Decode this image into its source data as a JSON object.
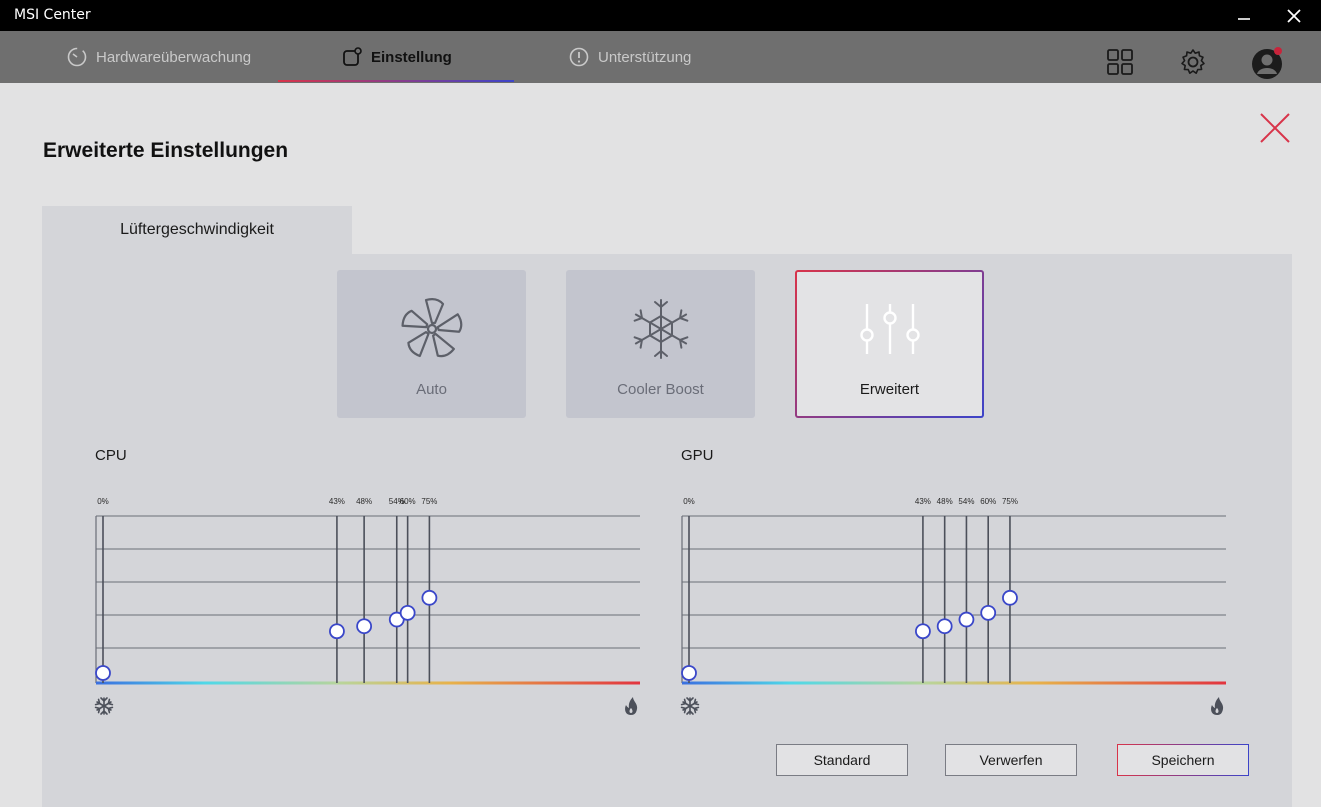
{
  "window": {
    "title": "MSI Center"
  },
  "nav": {
    "tabs": [
      {
        "label": "Hardwareüberwachung",
        "icon": "gauge-icon",
        "active": false
      },
      {
        "label": "Einstellung",
        "icon": "settings-square-icon",
        "active": true
      },
      {
        "label": "Unterstützung",
        "icon": "alert-circle-icon",
        "active": false
      }
    ],
    "right_icons": [
      "grid-icon",
      "gear-icon",
      "avatar"
    ]
  },
  "dialog": {
    "title": "Erweiterte Einstellungen",
    "tab": "Lüftergeschwindigkeit",
    "modes": [
      {
        "label": "Auto",
        "icon": "fan-icon",
        "selected": false
      },
      {
        "label": "Cooler Boost",
        "icon": "snowflake-icon",
        "selected": false
      },
      {
        "label": "Erweitert",
        "icon": "sliders-icon",
        "selected": true
      }
    ],
    "buttons": {
      "standard": "Standard",
      "discard": "Verwerfen",
      "save": "Speichern"
    }
  },
  "colors": {
    "accent_red": "#d8344a",
    "accent_blue": "#3c44c9",
    "handle_blue": "#3a47c9"
  },
  "charts": [
    {
      "label": "CPU",
      "points": [
        {
          "temp_label": "0%",
          "temp": 0,
          "level": 0.06
        },
        {
          "temp_label": "43%",
          "temp": 43,
          "level": 0.31
        },
        {
          "temp_label": "48%",
          "temp": 48,
          "level": 0.34
        },
        {
          "temp_label": "54%",
          "temp": 54,
          "level": 0.38
        },
        {
          "temp_label": "60%",
          "temp": 56,
          "level": 0.42
        },
        {
          "temp_label": "75%",
          "temp": 60,
          "level": 0.51
        }
      ]
    },
    {
      "label": "GPU",
      "points": [
        {
          "temp_label": "0%",
          "temp": 0,
          "level": 0.06
        },
        {
          "temp_label": "43%",
          "temp": 43,
          "level": 0.31
        },
        {
          "temp_label": "48%",
          "temp": 47,
          "level": 0.34
        },
        {
          "temp_label": "54%",
          "temp": 51,
          "level": 0.38
        },
        {
          "temp_label": "60%",
          "temp": 55,
          "level": 0.42
        },
        {
          "temp_label": "75%",
          "temp": 59,
          "level": 0.51
        }
      ]
    }
  ]
}
